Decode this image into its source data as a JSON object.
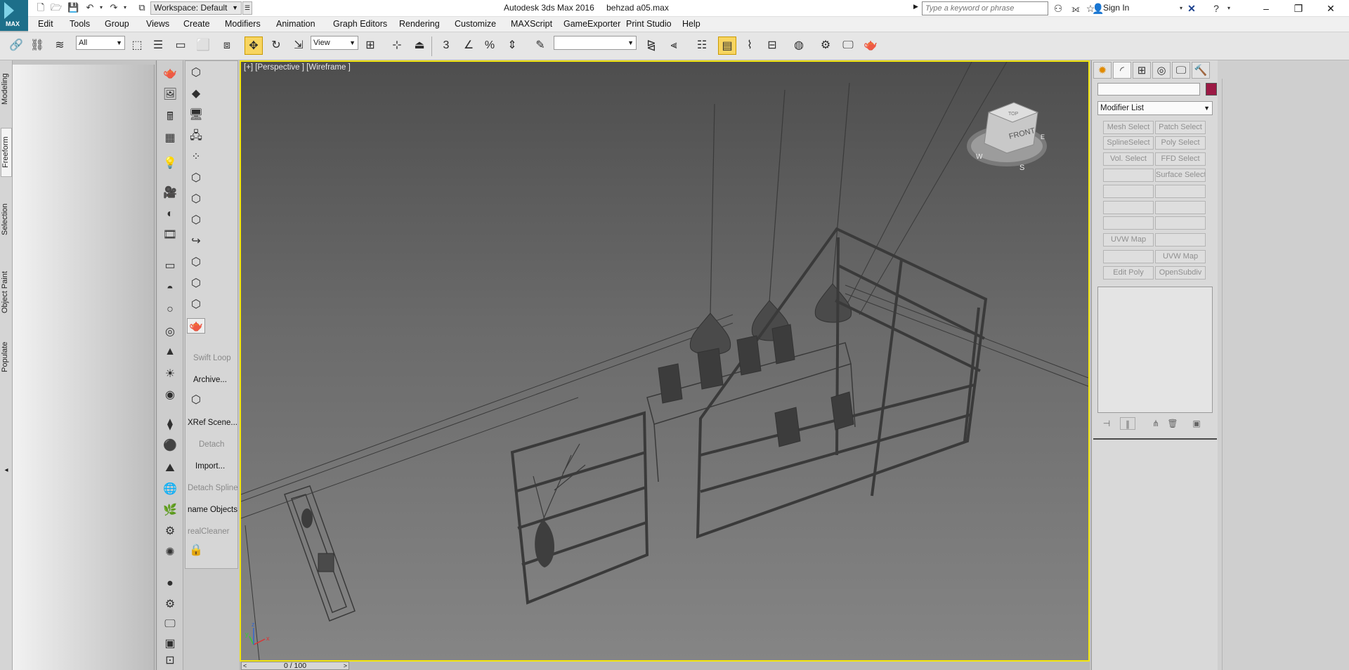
{
  "titlebar": {
    "app_logo_text": "MAX",
    "workspace": "Workspace: Default",
    "app_name": "Autodesk 3ds Max 2016",
    "file_name": "behzad a05.max",
    "search_placeholder": "Type a keyword or phrase",
    "sign_in": "Sign In"
  },
  "menu": [
    "Edit",
    "Tools",
    "Group",
    "Views",
    "Create",
    "Modifiers",
    "Animation",
    "Graph Editors",
    "Rendering",
    "Customize",
    "MAXScript",
    "GameExporter",
    "Print Studio",
    "Help"
  ],
  "toolbar": {
    "selection_filter": "All",
    "reference_coord": "View",
    "snaps_label": "3",
    "named_selection": ""
  },
  "ribbon": {
    "tabs": [
      "Modeling",
      "Freeform",
      "Selection",
      "Object Paint",
      "Populate"
    ],
    "active_tab": "Freeform"
  },
  "command_strip": {
    "labels": [
      {
        "text": "Swift Loop",
        "enabled": false
      },
      {
        "text": "Archive...",
        "enabled": true
      },
      {
        "text": "XRef Scene...",
        "enabled": true
      },
      {
        "text": "Detach",
        "enabled": false
      },
      {
        "text": "Import...",
        "enabled": true
      },
      {
        "text": "Detach Spline",
        "enabled": false
      },
      {
        "text": "name Objects",
        "enabled": true
      },
      {
        "text": "realCleaner",
        "enabled": false
      }
    ]
  },
  "viewport": {
    "label": "[+] [Perspective ] [Wireframe ]",
    "viewcube_face": "FRONT",
    "viewcube_top": "TOP",
    "compass": [
      "W",
      "S",
      "E"
    ],
    "axis_labels": [
      "x",
      "y",
      "z"
    ]
  },
  "timeline": {
    "frame": "0 / 100",
    "prev": "<",
    "next": ">"
  },
  "command_panel": {
    "modifier_list": "Modifier List",
    "object_color": "#9c1a45",
    "buttons": [
      [
        "Mesh Select",
        "Patch Select"
      ],
      [
        "SplineSelect",
        "Poly Select"
      ],
      [
        "Vol. Select",
        "FFD Select"
      ],
      [
        "",
        "Surface Select"
      ],
      [
        "",
        ""
      ],
      [
        "",
        ""
      ],
      [
        "",
        ""
      ],
      [
        "UVW Map",
        ""
      ],
      [
        "",
        "UVW Map"
      ],
      [
        "Edit Poly",
        "OpenSubdiv"
      ]
    ]
  },
  "colors": {
    "viewport_border": "#f3e60e",
    "active_tool": "#f8d560",
    "logo": "#1d6f8a"
  }
}
